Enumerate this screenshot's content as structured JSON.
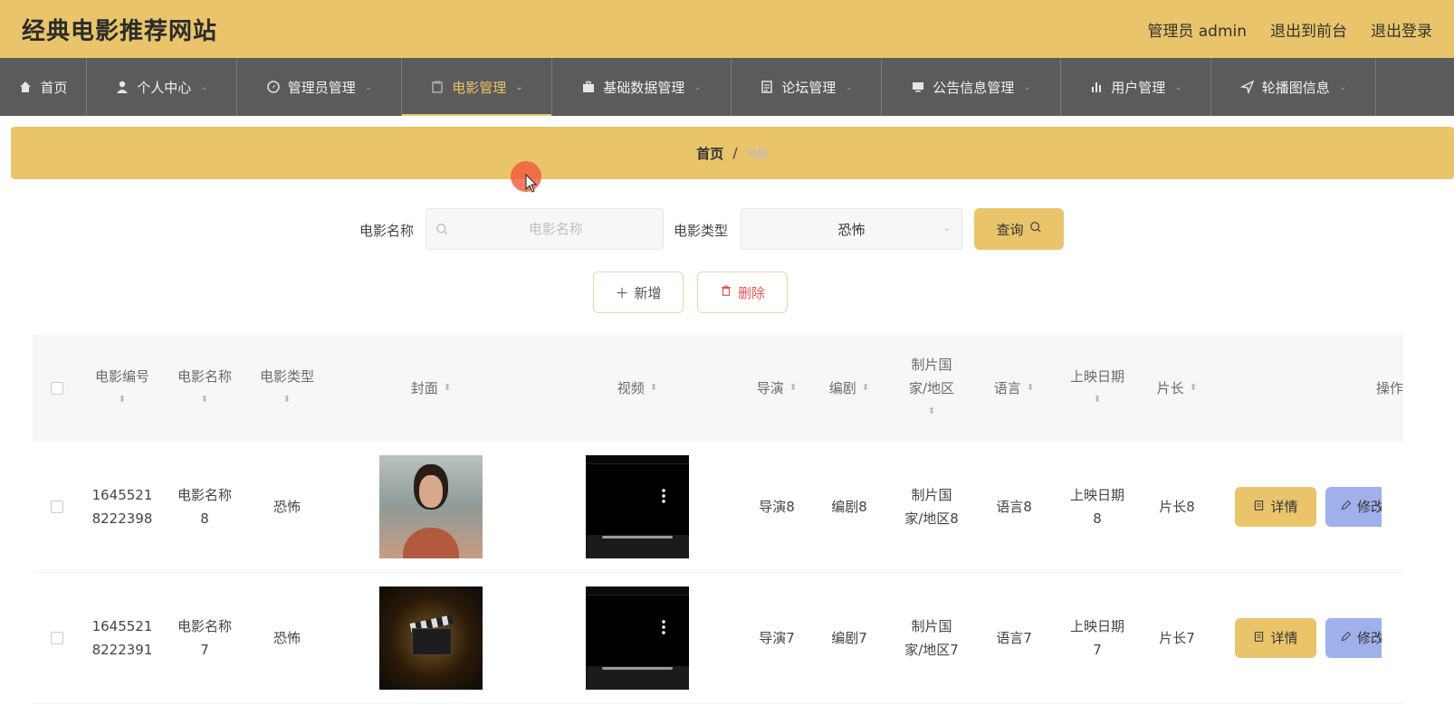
{
  "header": {
    "site_title": "经典电影推荐网站",
    "admin_label": "管理员 admin",
    "to_front": "退出到前台",
    "logout": "退出登录"
  },
  "nav": {
    "items": [
      {
        "label": "首页",
        "icon": "home-icon"
      },
      {
        "label": "个人中心",
        "icon": "user-icon"
      },
      {
        "label": "管理员管理",
        "icon": "compass-icon"
      },
      {
        "label": "电影管理",
        "icon": "film-icon",
        "active": true
      },
      {
        "label": "基础数据管理",
        "icon": "briefcase-icon"
      },
      {
        "label": "论坛管理",
        "icon": "document-icon"
      },
      {
        "label": "公告信息管理",
        "icon": "monitor-icon"
      },
      {
        "label": "用户管理",
        "icon": "chart-icon"
      },
      {
        "label": "轮播图信息",
        "icon": "send-icon"
      }
    ]
  },
  "breadcrumb": {
    "home": "首页",
    "separator": "/",
    "current": "电影"
  },
  "search": {
    "name_label": "电影名称",
    "name_placeholder": "电影名称",
    "type_label": "电影类型",
    "type_value": "恐怖",
    "query_label": "查询"
  },
  "actions": {
    "add_label": "新增",
    "delete_label": "删除"
  },
  "table": {
    "headers": {
      "id": "电影编号",
      "name": "电影名称",
      "type": "电影类型",
      "cover": "封面",
      "video": "视频",
      "director": "导演",
      "writer": "编剧",
      "country_line1": "制片国",
      "country_line2": "家/地区",
      "language": "语言",
      "date": "上映日期",
      "length": "片长",
      "ops": "操作"
    },
    "rows": [
      {
        "id_line1": "1645521",
        "id_line2": "8222398",
        "name_line1": "电影名称",
        "name_line2": "8",
        "type": "恐怖",
        "director": "导演8",
        "writer": "编剧8",
        "country_line1": "制片国",
        "country_line2": "家/地区8",
        "language": "语言8",
        "date_line1": "上映日期",
        "date_line2": "8",
        "length": "片长8",
        "detail_label": "详情",
        "edit_label": "修改"
      },
      {
        "id_line1": "1645521",
        "id_line2": "8222391",
        "name_line1": "电影名称",
        "name_line2": "7",
        "type": "恐怖",
        "director": "导演7",
        "writer": "编剧7",
        "country_line1": "制片国",
        "country_line2": "家/地区7",
        "language": "语言7",
        "date_line1": "上映日期",
        "date_line2": "7",
        "length": "片长7",
        "detail_label": "详情",
        "edit_label": "修改"
      }
    ]
  },
  "colors": {
    "accent": "#e9c46a",
    "nav_bg": "#5b5b5b",
    "edit_button": "#9fb0ea",
    "danger": "#e25555"
  }
}
